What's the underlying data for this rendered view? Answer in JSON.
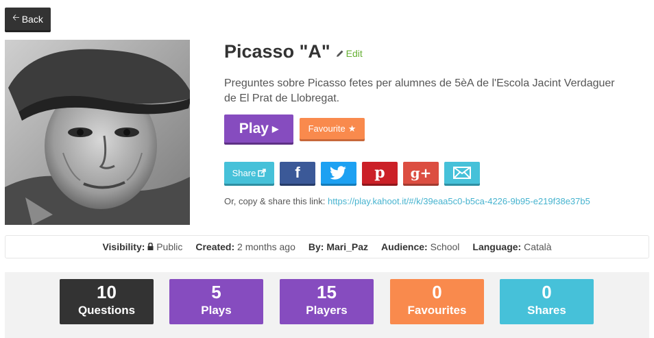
{
  "nav": {
    "back_label": "Back"
  },
  "kahoot": {
    "title": "Picasso \"A\"",
    "edit_label": "Edit",
    "description": "Preguntes sobre Picasso fetes per alumnes de 5èA de l'Escola Jacint Verdaguer de El Prat de Llobregat."
  },
  "actions": {
    "play_label": "Play",
    "favourite_label": "Favourite"
  },
  "share": {
    "share_label": "Share",
    "facebook_glyph": "f",
    "pinterest_glyph": "p",
    "googleplus_glyph": "g+",
    "link_prefix": "Or, copy & share this link:",
    "link_url": "https://play.kahoot.it/#/k/39eaa5c0-b5ca-4226-9b95-e219f38e37b5"
  },
  "meta": {
    "visibility_label": "Visibility:",
    "visibility_value": "Public",
    "created_label": "Created:",
    "created_value": "2 months ago",
    "by_label": "By:",
    "by_value": "Mari_Paz",
    "audience_label": "Audience:",
    "audience_value": "School",
    "language_label": "Language:",
    "language_value": "Català"
  },
  "stats": [
    {
      "value": "10",
      "label": "Questions",
      "color": "#333333"
    },
    {
      "value": "5",
      "label": "Plays",
      "color": "#864cbf"
    },
    {
      "value": "15",
      "label": "Players",
      "color": "#864cbf"
    },
    {
      "value": "0",
      "label": "Favourites",
      "color": "#f98a4d"
    },
    {
      "value": "0",
      "label": "Shares",
      "color": "#46c1d9"
    }
  ],
  "icons": [
    "arrow-left-icon",
    "pencil-icon",
    "play-triangle-icon",
    "star-icon",
    "share-external-icon",
    "facebook-icon",
    "twitter-icon",
    "pinterest-icon",
    "google-plus-icon",
    "envelope-icon",
    "lock-icon"
  ]
}
